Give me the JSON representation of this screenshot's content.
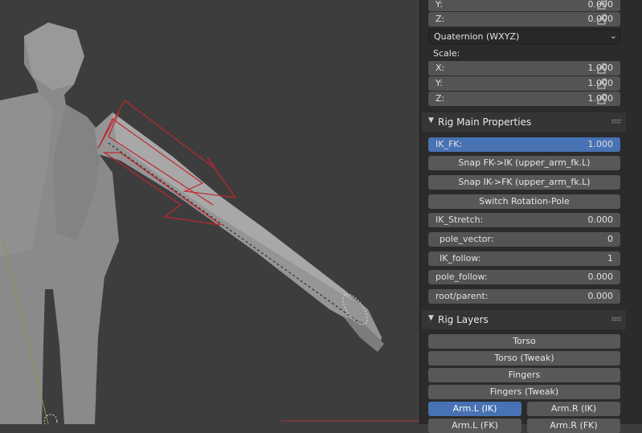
{
  "transform": {
    "location_y": {
      "label": "Y:",
      "value": "0.000"
    },
    "location_z": {
      "label": "Z:",
      "value": "0.000"
    },
    "rotation_mode": "Quaternion (WXYZ)",
    "scale_label": "Scale:",
    "scale": [
      {
        "label": "X:",
        "value": "1.000"
      },
      {
        "label": "Y:",
        "value": "1.000"
      },
      {
        "label": "Z:",
        "value": "1.000"
      }
    ]
  },
  "rig_main": {
    "title": "Rig Main Properties",
    "ik_fk": {
      "label": "IK_FK:",
      "value": "1.000"
    },
    "snap_fk_ik": "Snap FK->IK (upper_arm_fk.L)",
    "snap_ik_fk": "Snap IK->FK (upper_arm_fk.L)",
    "switch_pole": "Switch Rotation-Pole",
    "props": [
      {
        "label": "IK_Stretch:",
        "value": "0.000"
      },
      {
        "label": "pole_vector:",
        "value": "0"
      },
      {
        "label": "IK_follow:",
        "value": "1"
      },
      {
        "label": "pole_follow:",
        "value": "0.000"
      },
      {
        "label": "root/parent:",
        "value": "0.000"
      }
    ]
  },
  "rig_layers": {
    "title": "Rig Layers",
    "buttons": [
      "Torso",
      "Torso (Tweak)",
      "Fingers",
      "Fingers (Tweak)"
    ],
    "arm_l_ik": "Arm.L (IK)",
    "arm_r_ik": "Arm.R (IK)",
    "arm_l_fk": "Arm.L (FK)",
    "arm_r_fk": "Arm.R (FK)"
  },
  "colors": {
    "accent": "#4772b3",
    "ik_control": "#c0272d"
  },
  "icons": {
    "lock": "lock-icon",
    "collapse": "triangle-down-icon",
    "grip": "grip-icon"
  }
}
